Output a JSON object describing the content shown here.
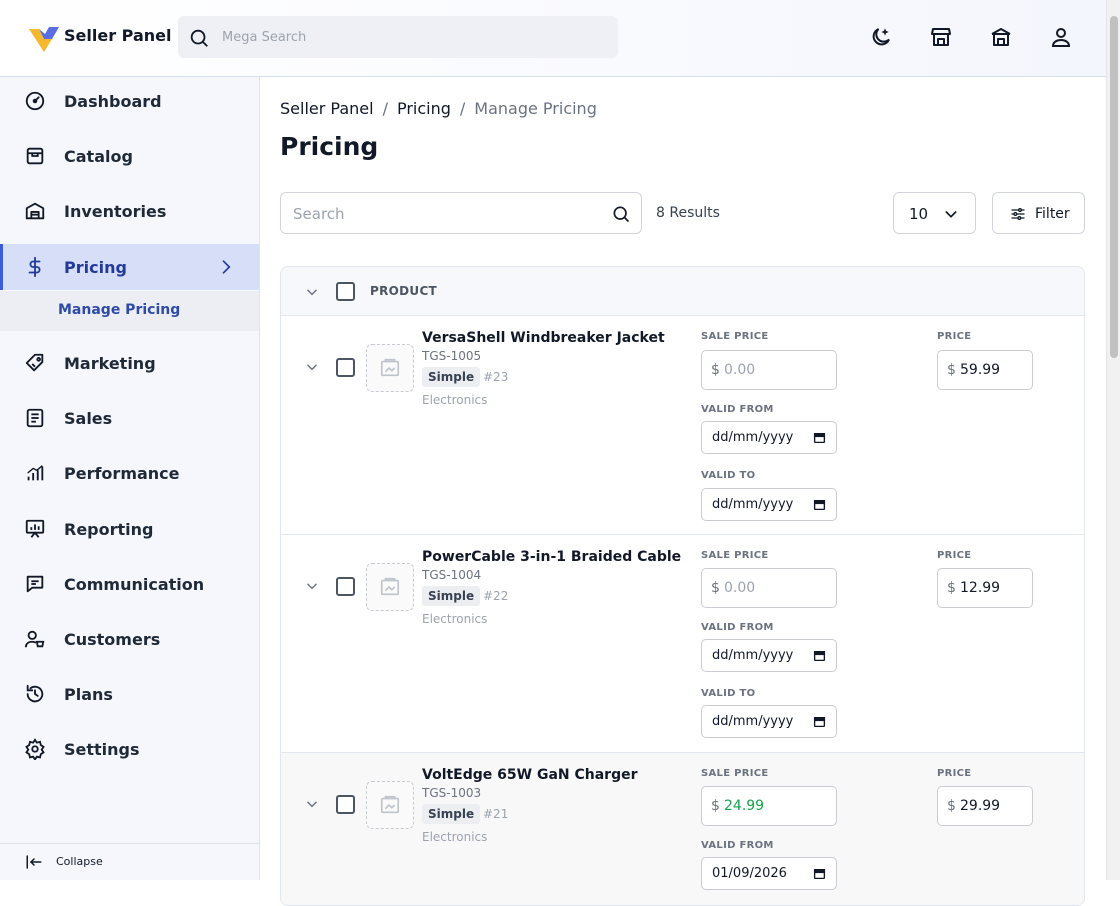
{
  "header": {
    "brand": "Seller Panel",
    "search_placeholder": "Mega Search",
    "icons": [
      "theme-toggle-icon",
      "store-icon",
      "marketplace-icon",
      "user-icon"
    ]
  },
  "sidebar": {
    "items": [
      {
        "label": "Dashboard",
        "icon": "dashboard-icon"
      },
      {
        "label": "Catalog",
        "icon": "catalog-icon"
      },
      {
        "label": "Inventories",
        "icon": "inventories-icon"
      },
      {
        "label": "Pricing",
        "icon": "dollar-icon",
        "active": true
      },
      {
        "label": "Marketing",
        "icon": "tag-icon"
      },
      {
        "label": "Sales",
        "icon": "sales-icon"
      },
      {
        "label": "Performance",
        "icon": "performance-icon"
      },
      {
        "label": "Reporting",
        "icon": "reporting-icon"
      },
      {
        "label": "Communication",
        "icon": "chat-icon"
      },
      {
        "label": "Customers",
        "icon": "customers-icon"
      },
      {
        "label": "Plans",
        "icon": "history-icon"
      },
      {
        "label": "Settings",
        "icon": "gear-icon"
      }
    ],
    "subitem": "Manage Pricing",
    "collapse_label": "Collapse"
  },
  "breadcrumb": {
    "root": "Seller Panel",
    "sep": "/",
    "section": "Pricing",
    "current": "Manage Pricing"
  },
  "page_title": "Pricing",
  "toolbar": {
    "search_placeholder": "Search",
    "results": "8 Results",
    "per_page": "10",
    "filter_label": "Filter"
  },
  "table": {
    "header": "PRODUCT",
    "labels": {
      "sale_price": "SALE PRICE",
      "price": "PRICE",
      "valid_from": "VALID FROM",
      "valid_to": "VALID TO",
      "currency": "$"
    },
    "rows": [
      {
        "name": "VersaShell Windbreaker Jacket",
        "sku": "TGS-1005",
        "type": "Simple",
        "id": "#23",
        "category": "Electronics",
        "sale_price": "",
        "sale_placeholder": "0.00",
        "price": "59.99",
        "valid_from": "dd/mm/yyyy",
        "valid_to": "dd/mm/yyyy"
      },
      {
        "name": "PowerCable 3-in-1 Braided Cable",
        "sku": "TGS-1004",
        "type": "Simple",
        "id": "#22",
        "category": "Electronics",
        "sale_price": "",
        "sale_placeholder": "0.00",
        "price": "12.99",
        "valid_from": "dd/mm/yyyy",
        "valid_to": "dd/mm/yyyy"
      },
      {
        "name": "VoltEdge 65W GaN Charger",
        "sku": "TGS-1003",
        "type": "Simple",
        "id": "#21",
        "category": "Electronics",
        "sale_price": "24.99",
        "sale_placeholder": "0.00",
        "price": "29.99",
        "valid_from": "01/09/2026",
        "valid_to": ""
      }
    ]
  },
  "colors": {
    "accent": "#3b5bdb",
    "active_bg": "#d6def8",
    "sale_green": "#16a34a",
    "logo_yellow": "#f5b82e"
  }
}
